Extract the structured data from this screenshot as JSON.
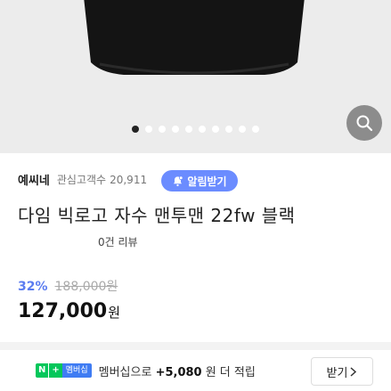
{
  "gallery": {
    "slide_count": 10,
    "active_index": 0
  },
  "seller": {
    "name": "예씨네",
    "fav_label": "관심고객수",
    "fav_count": "20,911"
  },
  "alarm_button": {
    "label": "알림받기"
  },
  "product": {
    "title": "다임 빅로고 자수 맨투맨 22fw 블랙",
    "review": "0건 리뷰"
  },
  "pricing": {
    "discount": "32%",
    "original": "188,000원",
    "price": "127,000",
    "currency": "원"
  },
  "membership": {
    "badge_n": "N",
    "badge_plus": "+",
    "badge_label": "멤버십",
    "text_prefix": "멤버십으로",
    "amount": "+5,080",
    "text_suffix": "원 더 적립",
    "button_label": "받기"
  },
  "colors": {
    "accent": "#5b7cf0",
    "alarm_bg": "#6b8cff",
    "naver_green": "#03c75a"
  },
  "icons": {
    "zoom": "search-icon",
    "alarm": "bell-icon",
    "chevron": "chevron-right-icon"
  }
}
